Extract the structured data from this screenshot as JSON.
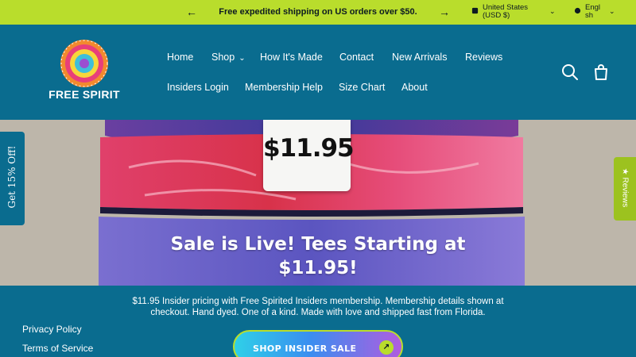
{
  "announcement": {
    "message": "Free expedited shipping on US orders over $50.",
    "prev_icon": "arrow-left-icon",
    "next_icon": "arrow-right-icon"
  },
  "locale": {
    "country_line1": "United States",
    "country_line2": "(USD $)",
    "language_line1": "Engl",
    "language_line2": "sh"
  },
  "brand": {
    "name": "FREE SPIRIT"
  },
  "nav": {
    "items": [
      "Home",
      "Shop",
      "How It's Made",
      "Contact",
      "New Arrivals",
      "Reviews",
      "Insiders Login",
      "Membership Help",
      "Size Chart",
      "About"
    ]
  },
  "hero": {
    "price_tag": "$11.95",
    "title_line1": "Sale is Live! Tees Starting at",
    "title_line2": "$11.95!"
  },
  "promo": {
    "description": "$11.95 Insider pricing with Free Spirited Insiders membership. Membership details shown at checkout. Hand dyed. One of a kind. Made with love and shipped fast from Florida.",
    "cta_label": "SHOP INSIDER SALE"
  },
  "footer_links": [
    "Privacy Policy",
    "Terms of Service"
  ],
  "side_tabs": {
    "discount": "Get 15% Off!",
    "reviews": "★ Reviews"
  },
  "colors": {
    "accent_lime": "#b9dd2c",
    "header_teal": "#0a6c8f"
  }
}
